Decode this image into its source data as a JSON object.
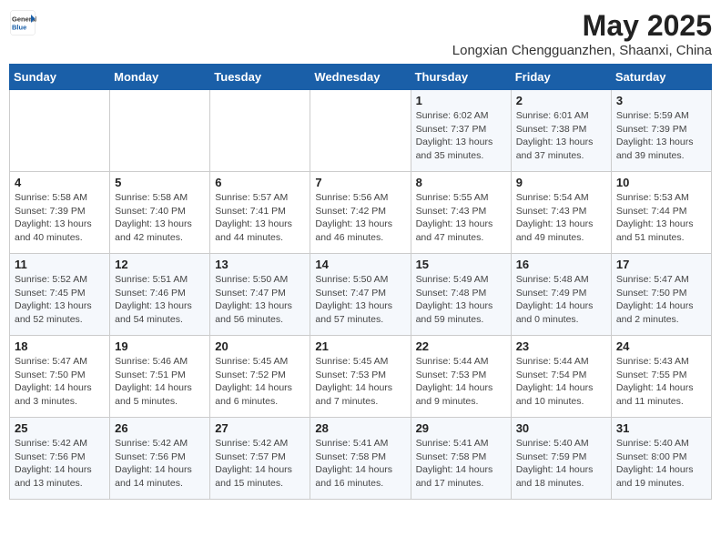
{
  "header": {
    "logo_general": "General",
    "logo_blue": "Blue",
    "month_title": "May 2025",
    "location": "Longxian Chengguanzhen, Shaanxi, China"
  },
  "weekdays": [
    "Sunday",
    "Monday",
    "Tuesday",
    "Wednesday",
    "Thursday",
    "Friday",
    "Saturday"
  ],
  "weeks": [
    [
      {
        "day": "",
        "info": ""
      },
      {
        "day": "",
        "info": ""
      },
      {
        "day": "",
        "info": ""
      },
      {
        "day": "",
        "info": ""
      },
      {
        "day": "1",
        "info": "Sunrise: 6:02 AM\nSunset: 7:37 PM\nDaylight: 13 hours\nand 35 minutes."
      },
      {
        "day": "2",
        "info": "Sunrise: 6:01 AM\nSunset: 7:38 PM\nDaylight: 13 hours\nand 37 minutes."
      },
      {
        "day": "3",
        "info": "Sunrise: 5:59 AM\nSunset: 7:39 PM\nDaylight: 13 hours\nand 39 minutes."
      }
    ],
    [
      {
        "day": "4",
        "info": "Sunrise: 5:58 AM\nSunset: 7:39 PM\nDaylight: 13 hours\nand 40 minutes."
      },
      {
        "day": "5",
        "info": "Sunrise: 5:58 AM\nSunset: 7:40 PM\nDaylight: 13 hours\nand 42 minutes."
      },
      {
        "day": "6",
        "info": "Sunrise: 5:57 AM\nSunset: 7:41 PM\nDaylight: 13 hours\nand 44 minutes."
      },
      {
        "day": "7",
        "info": "Sunrise: 5:56 AM\nSunset: 7:42 PM\nDaylight: 13 hours\nand 46 minutes."
      },
      {
        "day": "8",
        "info": "Sunrise: 5:55 AM\nSunset: 7:43 PM\nDaylight: 13 hours\nand 47 minutes."
      },
      {
        "day": "9",
        "info": "Sunrise: 5:54 AM\nSunset: 7:43 PM\nDaylight: 13 hours\nand 49 minutes."
      },
      {
        "day": "10",
        "info": "Sunrise: 5:53 AM\nSunset: 7:44 PM\nDaylight: 13 hours\nand 51 minutes."
      }
    ],
    [
      {
        "day": "11",
        "info": "Sunrise: 5:52 AM\nSunset: 7:45 PM\nDaylight: 13 hours\nand 52 minutes."
      },
      {
        "day": "12",
        "info": "Sunrise: 5:51 AM\nSunset: 7:46 PM\nDaylight: 13 hours\nand 54 minutes."
      },
      {
        "day": "13",
        "info": "Sunrise: 5:50 AM\nSunset: 7:47 PM\nDaylight: 13 hours\nand 56 minutes."
      },
      {
        "day": "14",
        "info": "Sunrise: 5:50 AM\nSunset: 7:47 PM\nDaylight: 13 hours\nand 57 minutes."
      },
      {
        "day": "15",
        "info": "Sunrise: 5:49 AM\nSunset: 7:48 PM\nDaylight: 13 hours\nand 59 minutes."
      },
      {
        "day": "16",
        "info": "Sunrise: 5:48 AM\nSunset: 7:49 PM\nDaylight: 14 hours\nand 0 minutes."
      },
      {
        "day": "17",
        "info": "Sunrise: 5:47 AM\nSunset: 7:50 PM\nDaylight: 14 hours\nand 2 minutes."
      }
    ],
    [
      {
        "day": "18",
        "info": "Sunrise: 5:47 AM\nSunset: 7:50 PM\nDaylight: 14 hours\nand 3 minutes."
      },
      {
        "day": "19",
        "info": "Sunrise: 5:46 AM\nSunset: 7:51 PM\nDaylight: 14 hours\nand 5 minutes."
      },
      {
        "day": "20",
        "info": "Sunrise: 5:45 AM\nSunset: 7:52 PM\nDaylight: 14 hours\nand 6 minutes."
      },
      {
        "day": "21",
        "info": "Sunrise: 5:45 AM\nSunset: 7:53 PM\nDaylight: 14 hours\nand 7 minutes."
      },
      {
        "day": "22",
        "info": "Sunrise: 5:44 AM\nSunset: 7:53 PM\nDaylight: 14 hours\nand 9 minutes."
      },
      {
        "day": "23",
        "info": "Sunrise: 5:44 AM\nSunset: 7:54 PM\nDaylight: 14 hours\nand 10 minutes."
      },
      {
        "day": "24",
        "info": "Sunrise: 5:43 AM\nSunset: 7:55 PM\nDaylight: 14 hours\nand 11 minutes."
      }
    ],
    [
      {
        "day": "25",
        "info": "Sunrise: 5:42 AM\nSunset: 7:56 PM\nDaylight: 14 hours\nand 13 minutes."
      },
      {
        "day": "26",
        "info": "Sunrise: 5:42 AM\nSunset: 7:56 PM\nDaylight: 14 hours\nand 14 minutes."
      },
      {
        "day": "27",
        "info": "Sunrise: 5:42 AM\nSunset: 7:57 PM\nDaylight: 14 hours\nand 15 minutes."
      },
      {
        "day": "28",
        "info": "Sunrise: 5:41 AM\nSunset: 7:58 PM\nDaylight: 14 hours\nand 16 minutes."
      },
      {
        "day": "29",
        "info": "Sunrise: 5:41 AM\nSunset: 7:58 PM\nDaylight: 14 hours\nand 17 minutes."
      },
      {
        "day": "30",
        "info": "Sunrise: 5:40 AM\nSunset: 7:59 PM\nDaylight: 14 hours\nand 18 minutes."
      },
      {
        "day": "31",
        "info": "Sunrise: 5:40 AM\nSunset: 8:00 PM\nDaylight: 14 hours\nand 19 minutes."
      }
    ]
  ]
}
